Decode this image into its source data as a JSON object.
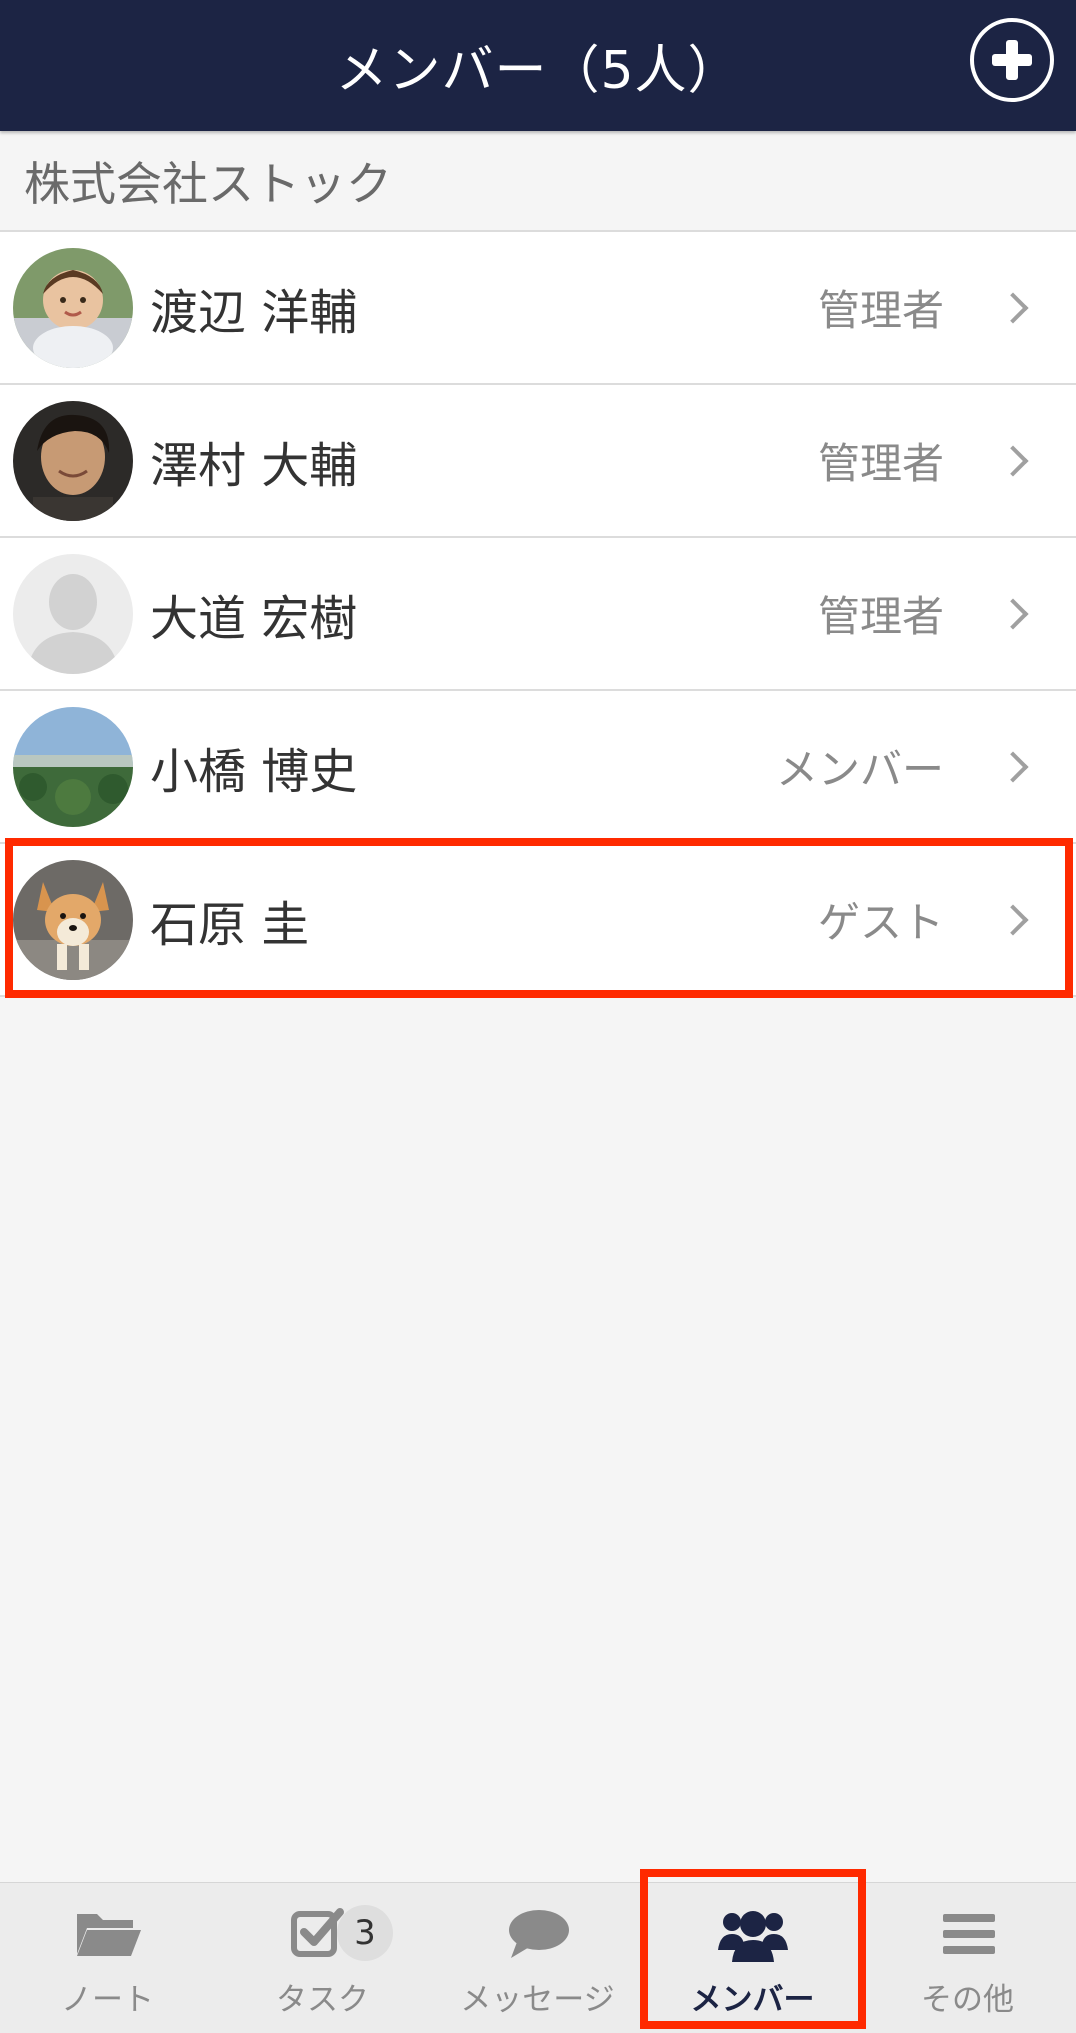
{
  "header": {
    "title": "メンバー（5人）",
    "add_icon": "plus-circle-icon",
    "bg_color": "#1c2444"
  },
  "organization": {
    "name": "株式会社ストック"
  },
  "members": [
    {
      "name": "渡辺 洋輔",
      "role": "管理者",
      "avatar": "child-photo"
    },
    {
      "name": "澤村 大輔",
      "role": "管理者",
      "avatar": "man-photo"
    },
    {
      "name": "大道 宏樹",
      "role": "管理者",
      "avatar": "default-person-placeholder"
    },
    {
      "name": "小橋 博史",
      "role": "メンバー",
      "avatar": "landscape-photo"
    },
    {
      "name": "石原 圭",
      "role": "ゲスト",
      "avatar": "dog-photo"
    }
  ],
  "tabs": [
    {
      "label": "ノート",
      "icon": "folder-icon",
      "active": false
    },
    {
      "label": "タスク",
      "icon": "checkbox-icon",
      "active": false,
      "badge": "3"
    },
    {
      "label": "メッセージ",
      "icon": "chat-bubble-icon",
      "active": false
    },
    {
      "label": "メンバー",
      "icon": "users-icon",
      "active": true
    },
    {
      "label": "その他",
      "icon": "menu-icon",
      "active": false
    }
  ],
  "highlight_color": "#ff2a00"
}
